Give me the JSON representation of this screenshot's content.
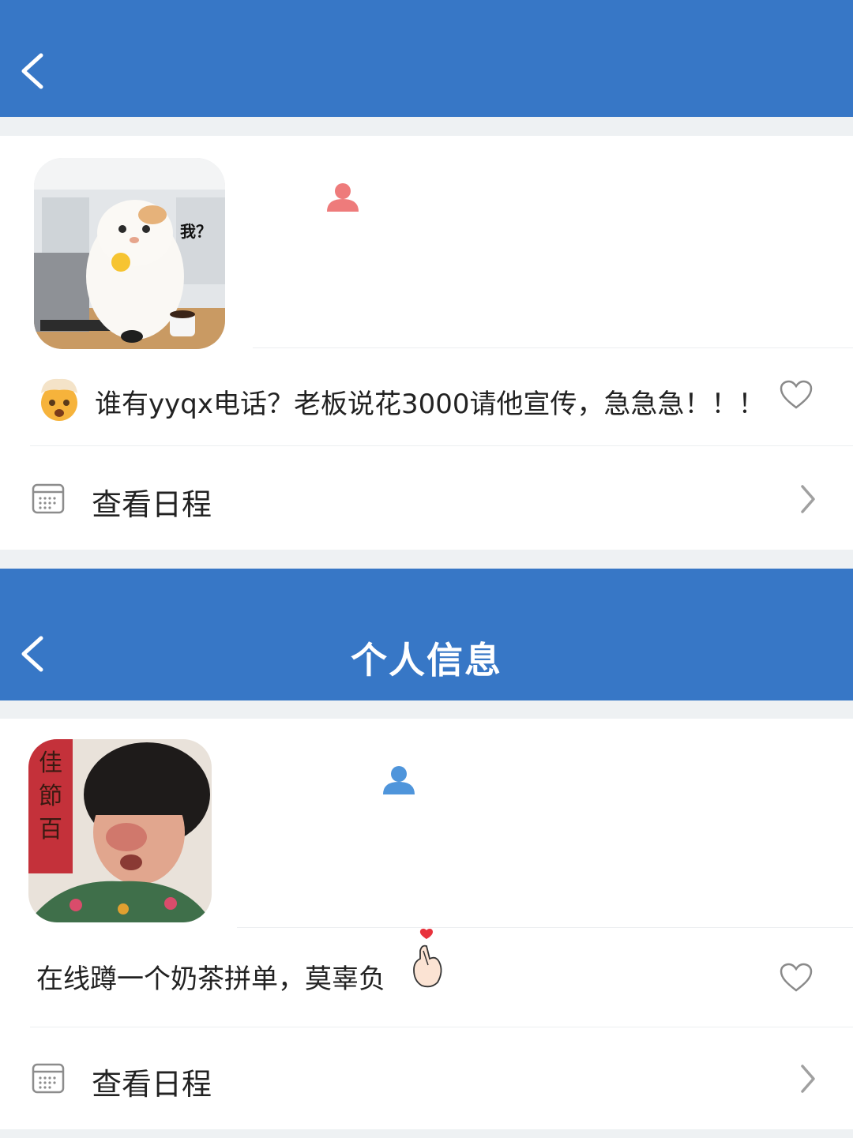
{
  "panels": [
    {
      "header_title": "",
      "avatar_caption": "我？",
      "status_text": "谁有yyqx电话？老板说花3000请他宣传，急急急！！！",
      "status_emoji": "exploding-head-icon",
      "user_icon_color": "#ee7b7b",
      "schedule_label": "查看日程"
    },
    {
      "header_title": "个人信息",
      "status_text": "在线蹲一个奶茶拼单，莫辜负",
      "status_emoji": "finger-heart-icon",
      "user_icon_color": "#4f95db",
      "schedule_label": "查看日程"
    }
  ],
  "colors": {
    "header_bg": "#3777c6",
    "page_bg": "#eef1f3",
    "card_bg": "#ffffff",
    "text": "#222222",
    "icon_gray": "#9a9a9a"
  }
}
